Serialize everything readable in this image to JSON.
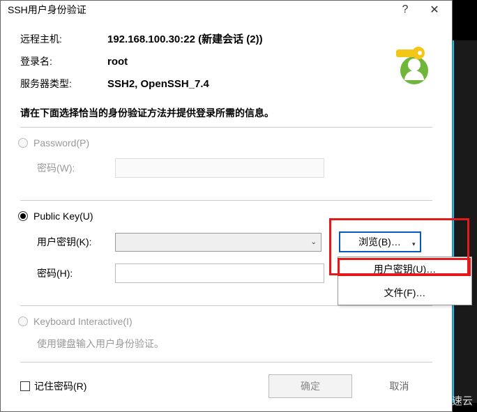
{
  "dialog": {
    "title": "SSH用户身份验证",
    "help_icon": "?",
    "close_icon": "✕"
  },
  "info": {
    "remote_host_label": "远程主机:",
    "remote_host_value": "192.168.100.30:22 (新建会话 (2))",
    "login_label": "登录名:",
    "login_value": "root",
    "server_type_label": "服务器类型:",
    "server_type_value": "SSH2, OpenSSH_7.4"
  },
  "instruction": "请在下面选择恰当的身份验证方法并提供登录所需的信息。",
  "password_group": {
    "radio_label": "Password(P)",
    "password_label": "密码(W):"
  },
  "publickey_group": {
    "radio_label": "Public Key(U)",
    "user_key_label": "用户密钥(K):",
    "password_label": "密码(H):",
    "browse_label": "浏览(B)…"
  },
  "keyboard_group": {
    "radio_label": "Keyboard Interactive(I)",
    "hint": "使用键盘输入用户身份验证。"
  },
  "browse_menu": {
    "user_key": "用户密钥(U)…",
    "file": "文件(F)…"
  },
  "footer": {
    "remember_label": "记住密码(R)",
    "ok": "确定",
    "cancel": "取消"
  },
  "watermark": "亿速云"
}
